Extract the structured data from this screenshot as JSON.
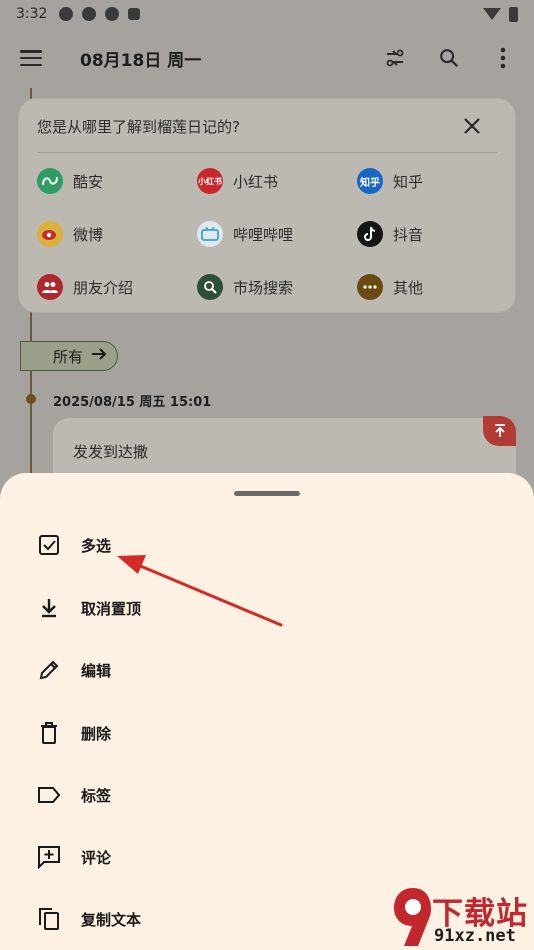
{
  "status_bar": {
    "time": "3:32"
  },
  "app_bar": {
    "date_title": "08月18日 周一"
  },
  "survey": {
    "question": "您是从哪里了解到榴莲日记的?",
    "options": [
      {
        "label": "酷安",
        "badge_text": "",
        "color": "#2f9d63"
      },
      {
        "label": "小红书",
        "badge_text": "小红书",
        "color": "#c7282b"
      },
      {
        "label": "知乎",
        "badge_text": "知乎",
        "color": "#1767c6"
      },
      {
        "label": "微博",
        "badge_text": "",
        "color": "#d9b23a"
      },
      {
        "label": "哔哩哔哩",
        "badge_text": "",
        "color": "#6ab4d6"
      },
      {
        "label": "抖音",
        "badge_text": "",
        "color": "#151515"
      },
      {
        "label": "朋友介绍",
        "badge_text": "",
        "color": "#b0262d"
      },
      {
        "label": "市场搜索",
        "badge_text": "",
        "color": "#2f4f3b"
      },
      {
        "label": "其他",
        "badge_text": "",
        "color": "#6a4a12"
      }
    ]
  },
  "filter_chip": {
    "label": "所有"
  },
  "entry": {
    "date": "2025/08/15 周五 15:01",
    "content": "发发到达撒"
  },
  "bottom_sheet": {
    "items": [
      {
        "label": "多选",
        "icon": "checkbox-icon"
      },
      {
        "label": "取消置顶",
        "icon": "download-icon"
      },
      {
        "label": "编辑",
        "icon": "pencil-icon"
      },
      {
        "label": "删除",
        "icon": "trash-icon"
      },
      {
        "label": "标签",
        "icon": "label-icon"
      },
      {
        "label": "评论",
        "icon": "add-comment-icon"
      },
      {
        "label": "复制文本",
        "icon": "copy-icon"
      }
    ]
  },
  "watermark": {
    "title": "下载站",
    "url": "91xz.net"
  },
  "colors": {
    "sheet_background": "#fdf1e3",
    "dimmed_background": "#a6a39e",
    "arrow": "#d42a25",
    "pin_badge": "#b33b35"
  }
}
